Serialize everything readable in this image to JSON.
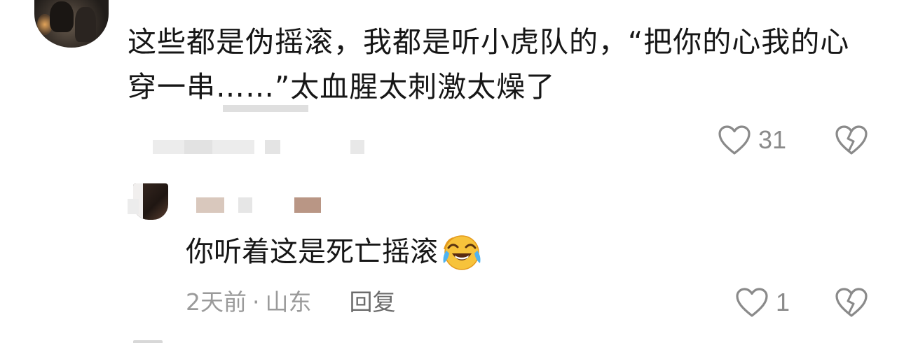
{
  "comment": {
    "text": "这些都是伪摇滚，我都是听小虎队的，“把你的心我的心穿一串……”太血腥太刺激太燥了",
    "like_count": "31"
  },
  "reply": {
    "text": "你听着这是死亡摇滚",
    "time": "2天前",
    "separator": "·",
    "location": "山东",
    "reply_label": "回复",
    "like_count": "1"
  },
  "icons": {
    "like": "heart-outline-icon",
    "dislike": "broken-heart-icon",
    "emoji": "crying-laughing-emoji"
  },
  "colors": {
    "text": "#161616",
    "meta": "#9a9a9a",
    "icon": "#8a8a8a"
  }
}
